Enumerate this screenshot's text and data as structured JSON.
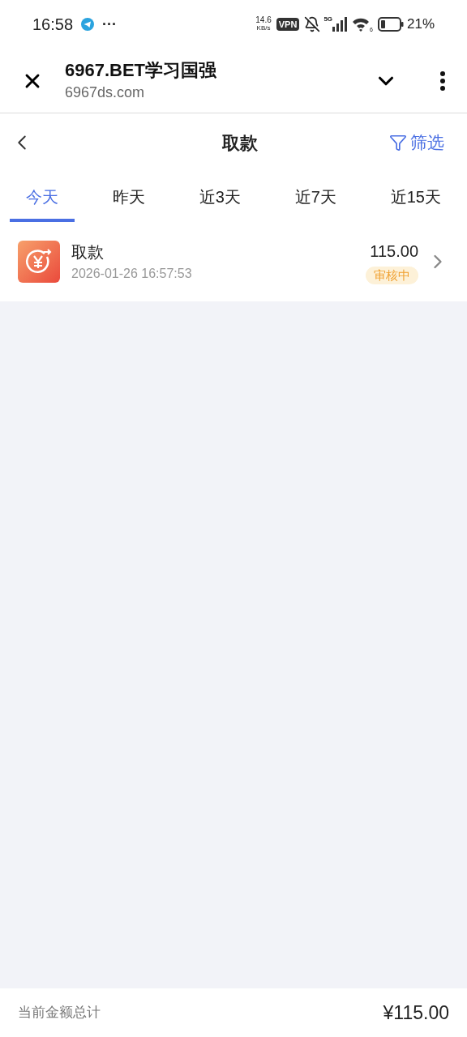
{
  "status_bar": {
    "time": "16:58",
    "more": "···",
    "speed_value": "14.6",
    "speed_unit": "KB/s",
    "vpn": "VPN",
    "network": "5G",
    "wifi_badge": "6",
    "battery": "21%"
  },
  "browser": {
    "title": "6967.BET学习国强",
    "url": "6967ds.com"
  },
  "header": {
    "title": "取款",
    "filter": "筛选"
  },
  "tabs": [
    {
      "label": "今天",
      "selected": true
    },
    {
      "label": "昨天",
      "selected": false
    },
    {
      "label": "近3天",
      "selected": false
    },
    {
      "label": "近7天",
      "selected": false
    },
    {
      "label": "近15天",
      "selected": false
    }
  ],
  "records": [
    {
      "title": "取款",
      "time": "2026-01-26 16:57:53",
      "amount": "115.00",
      "status": "审核中"
    }
  ],
  "footer": {
    "label": "当前金额总计",
    "total": "¥115.00"
  }
}
